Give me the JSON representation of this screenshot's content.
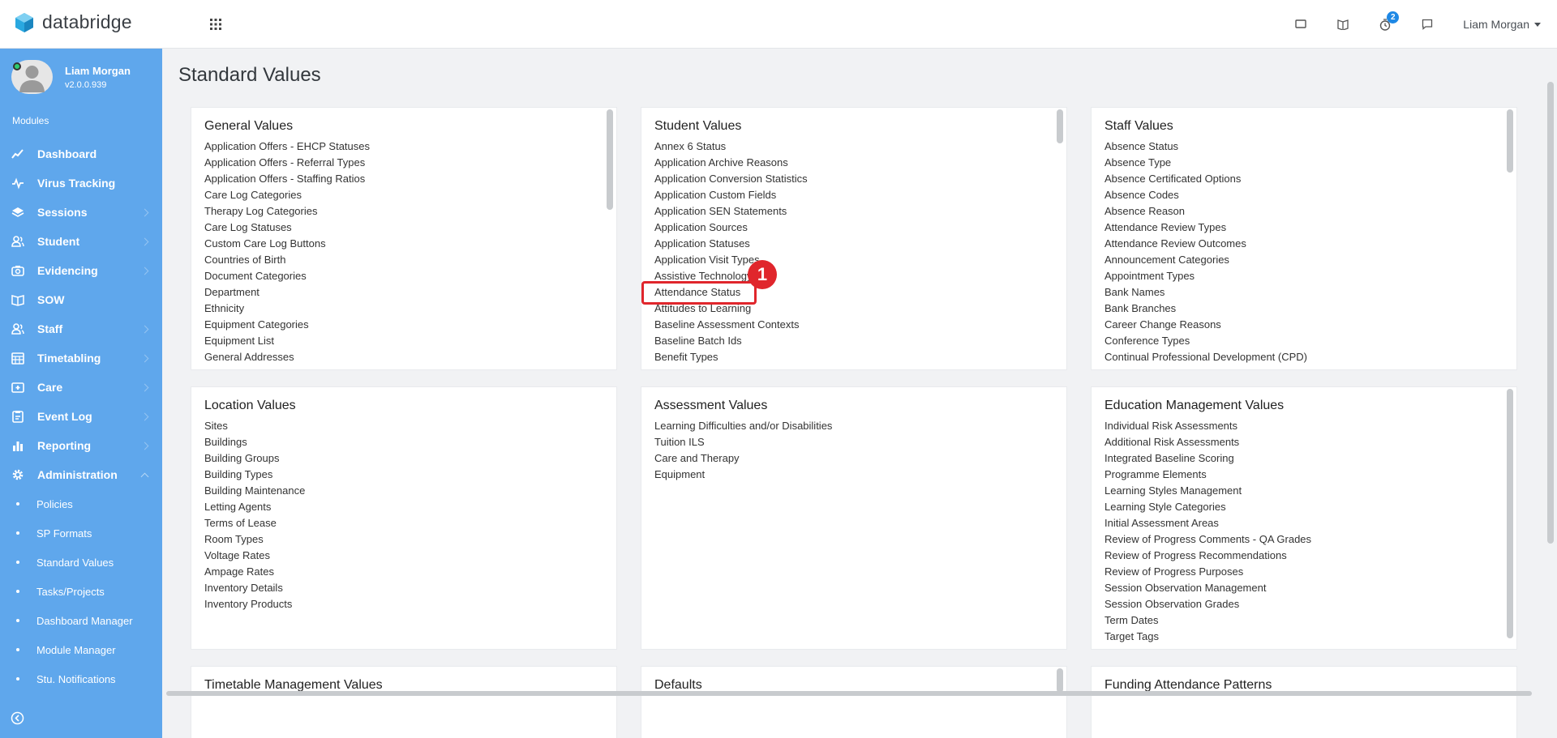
{
  "app": {
    "brand": "databridge",
    "brand_color": "#29a8e0"
  },
  "topbar": {
    "icons": [
      "screen-icon",
      "book-icon",
      "timer-icon",
      "chat-icon"
    ],
    "notification_count": "2",
    "user_name": "Liam Morgan"
  },
  "sidebar": {
    "profile": {
      "name": "Liam Morgan",
      "version": "v2.0.0.939"
    },
    "modules_label": "Modules",
    "items": [
      {
        "label": "Dashboard",
        "icon": "chart-line-icon"
      },
      {
        "label": "Virus Tracking",
        "icon": "pulse-icon"
      },
      {
        "label": "Sessions",
        "icon": "layers-icon"
      },
      {
        "label": "Student",
        "icon": "people-icon"
      },
      {
        "label": "Evidencing",
        "icon": "camera-icon"
      },
      {
        "label": "SOW",
        "icon": "book-open-icon"
      },
      {
        "label": "Staff",
        "icon": "people-icon"
      },
      {
        "label": "Timetabling",
        "icon": "calendar-icon"
      },
      {
        "label": "Care",
        "icon": "first-aid-icon"
      },
      {
        "label": "Event Log",
        "icon": "clipboard-icon"
      },
      {
        "label": "Reporting",
        "icon": "bar-chart-icon"
      },
      {
        "label": "Administration",
        "icon": "gear-icon"
      }
    ],
    "admin_subitems": [
      "Policies",
      "SP Formats",
      "Standard Values",
      "Tasks/Projects",
      "Dashboard Manager",
      "Module Manager",
      "Stu. Notifications"
    ]
  },
  "page": {
    "title": "Standard Values"
  },
  "panels": {
    "general": {
      "title": "General Values",
      "items": [
        "Application Offers - EHCP Statuses",
        "Application Offers - Referral Types",
        "Application Offers - Staffing Ratios",
        "Care Log Categories",
        "Therapy Log Categories",
        "Care Log Statuses",
        "Custom Care Log Buttons",
        "Countries of Birth",
        "Document Categories",
        "Department",
        "Ethnicity",
        "Equipment Categories",
        "Equipment List",
        "General Addresses"
      ]
    },
    "student": {
      "title": "Student Values",
      "items": [
        "Annex 6 Status",
        "Application Archive Reasons",
        "Application Conversion Statistics",
        "Application Custom Fields",
        "Application SEN Statements",
        "Application Sources",
        "Application Statuses",
        "Application Visit Types",
        "Assistive Technology",
        "Attendance Status",
        "Attitudes to Learning",
        "Baseline Assessment Contexts",
        "Baseline Batch Ids",
        "Benefit Types"
      ]
    },
    "staff": {
      "title": "Staff Values",
      "items": [
        "Absence Status",
        "Absence Type",
        "Absence Certificated Options",
        "Absence Codes",
        "Absence Reason",
        "Attendance Review Types",
        "Attendance Review Outcomes",
        "Announcement Categories",
        "Appointment Types",
        "Bank Names",
        "Bank Branches",
        "Career Change Reasons",
        "Conference Types",
        "Continual Professional Development (CPD)"
      ]
    },
    "location": {
      "title": "Location Values",
      "items": [
        "Sites",
        "Buildings",
        "Building Groups",
        "Building Types",
        "Building Maintenance",
        "Letting Agents",
        "Terms of Lease",
        "Room Types",
        "Voltage Rates",
        "Ampage Rates",
        "Inventory Details",
        "Inventory Products"
      ]
    },
    "assessment": {
      "title": "Assessment Values",
      "items": [
        "Learning Difficulties and/or Disabilities",
        "Tuition ILS",
        "Care and Therapy",
        "Equipment"
      ]
    },
    "education": {
      "title": "Education Management Values",
      "items": [
        "Individual Risk Assessments",
        "Additional Risk Assessments",
        "Integrated Baseline Scoring",
        "Programme Elements",
        "Learning Styles Management",
        "Learning Style Categories",
        "Initial Assessment Areas",
        "Review of Progress Comments - QA Grades",
        "Review of Progress Recommendations",
        "Review of Progress Purposes",
        "Session Observation Management",
        "Session Observation Grades",
        "Term Dates",
        "Target Tags"
      ]
    },
    "timetable": {
      "title": "Timetable Management Values"
    },
    "defaults": {
      "title": "Defaults"
    },
    "funding": {
      "title": "Funding Attendance Patterns"
    }
  },
  "annotation": {
    "marker_label": "1",
    "highlight_color": "#e0262c"
  }
}
